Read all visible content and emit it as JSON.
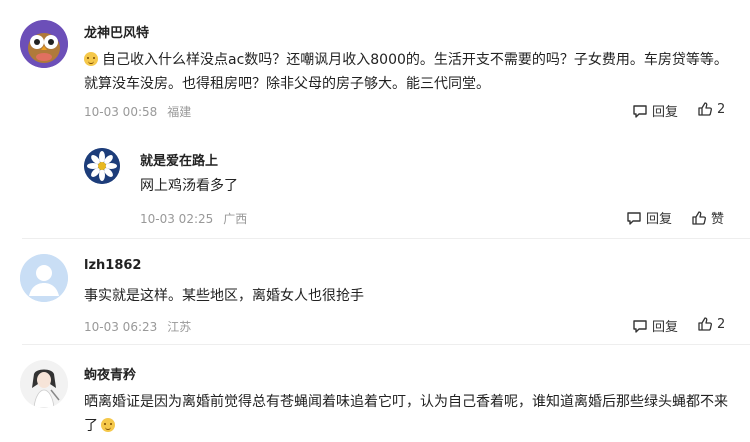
{
  "comments": [
    {
      "author": "龙神巴风特",
      "text": "自己收入什么样没点ac数吗？还嘲讽月收入8000的。生活开支不需要的吗？子女费用。车房贷等等。就算没车没房。也得租房吧？除非父母的房子够大。能三代同堂。",
      "date": "10-03 00:58",
      "location": "福建",
      "reply_label": "回复",
      "like_count": "2",
      "reply": {
        "author": "就是爱在路上",
        "text": "网上鸡汤看多了",
        "date": "10-03 02:25",
        "location": "广西",
        "reply_label": "回复",
        "like_label": "赞"
      }
    },
    {
      "author": "lzh1862",
      "text": "事实就是这样。某些地区，离婚女人也很抢手",
      "date": "10-03 06:23",
      "location": "江苏",
      "reply_label": "回复",
      "like_count": "2"
    },
    {
      "author": "蚼夜青矜",
      "text": "晒离婚证是因为离婚前觉得总有苍蝇闻着味追着它叮，认为自己香着呢，谁知道离婚后那些绿头蝇都不来了"
    }
  ]
}
